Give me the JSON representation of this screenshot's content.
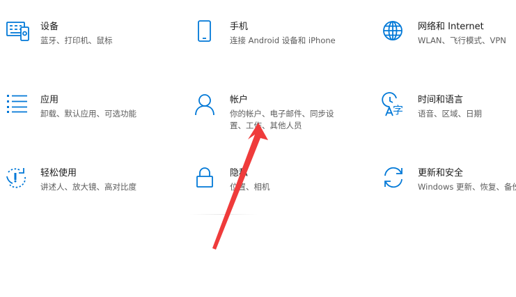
{
  "colors": {
    "accent": "#0078d7",
    "arrow": "#ef3b3b"
  },
  "tiles": [
    {
      "icon": "devices-icon",
      "title": "设备",
      "desc": "蓝牙、打印机、鼠标"
    },
    {
      "icon": "phone-icon",
      "title": "手机",
      "desc": "连接 Android 设备和 iPhone"
    },
    {
      "icon": "network-globe-icon",
      "title": "网络和 Internet",
      "desc": "WLAN、飞行模式、VPN"
    },
    {
      "icon": "apps-list-icon",
      "title": "应用",
      "desc": "卸载、默认应用、可选功能"
    },
    {
      "icon": "account-person-icon",
      "title": "帐户",
      "desc": "你的帐户、电子邮件、同步设置、工作、其他人员"
    },
    {
      "icon": "time-language-icon",
      "title": "时间和语言",
      "desc": "语音、区域、日期"
    },
    {
      "icon": "ease-of-access-icon",
      "title": "轻松使用",
      "desc": "讲述人、放大镜、高对比度"
    },
    {
      "icon": "lock-icon",
      "title": "隐私",
      "desc": "位置、相机"
    },
    {
      "icon": "update-sync-icon",
      "title": "更新和安全",
      "desc": "Windows 更新、恢复、备份"
    }
  ]
}
